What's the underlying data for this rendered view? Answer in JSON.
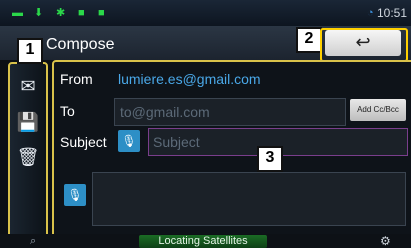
{
  "status": {
    "clock": "10:51",
    "icons": [
      "usb-icon",
      "download-icon",
      "settings-icon",
      "notification-icon",
      "wifi-icon"
    ]
  },
  "header": {
    "title": "Compose",
    "back_glyph": "↩"
  },
  "callouts": {
    "one": "1",
    "two": "2",
    "three": "3"
  },
  "sidebar": {
    "items": [
      {
        "icon": "send-mail-icon",
        "glyph": "✉"
      },
      {
        "icon": "save-icon",
        "glyph": "💾"
      },
      {
        "icon": "delete-icon",
        "glyph": "🗑"
      }
    ]
  },
  "form": {
    "from_label": "From",
    "from_value": "lumiere.es@gmail.com",
    "to_label": "To",
    "to_placeholder": "to@gmail.com",
    "add_cc_label": "Add Cc/Bcc",
    "subject_label": "Subject",
    "subject_placeholder": "Subject",
    "mic_glyph": "🎙"
  },
  "footer": {
    "status_text": "Locating Satellites"
  },
  "colors": {
    "accent": "#2d8fc6",
    "frame": "#d9c24a",
    "satellite_bg": "#1b6c25"
  }
}
